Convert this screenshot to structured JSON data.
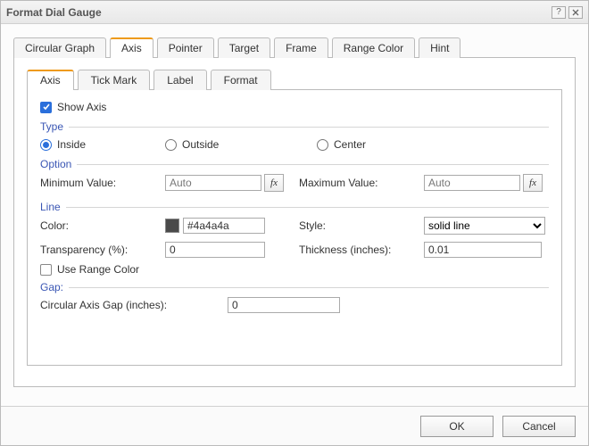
{
  "window": {
    "title": "Format Dial Gauge"
  },
  "outer_tabs": {
    "items": [
      {
        "label": "Circular Graph"
      },
      {
        "label": "Axis"
      },
      {
        "label": "Pointer"
      },
      {
        "label": "Target"
      },
      {
        "label": "Frame"
      },
      {
        "label": "Range Color"
      },
      {
        "label": "Hint"
      }
    ],
    "active": 1
  },
  "inner_tabs": {
    "items": [
      {
        "label": "Axis"
      },
      {
        "label": "Tick Mark"
      },
      {
        "label": "Label"
      },
      {
        "label": "Format"
      }
    ],
    "active": 0
  },
  "show_axis": {
    "label": "Show Axis",
    "checked": true
  },
  "groups": {
    "type": "Type",
    "option": "Option",
    "line": "Line",
    "gap": "Gap:"
  },
  "type_options": {
    "inside": "Inside",
    "outside": "Outside",
    "center": "Center",
    "selected": "inside"
  },
  "option_fields": {
    "min_label": "Minimum Value:",
    "min_value": "Auto",
    "max_label": "Maximum Value:",
    "max_value": "Auto",
    "fx_label": "fx"
  },
  "line_fields": {
    "color_label": "Color:",
    "color_value": "#4a4a4a",
    "color_hex": "#4a4a4a",
    "style_label": "Style:",
    "style_value": "solid line",
    "transparency_label": "Transparency (%):",
    "transparency_value": "0",
    "thickness_label": "Thickness (inches):",
    "thickness_value": "0.01",
    "use_range_color_label": "Use Range Color",
    "use_range_color_checked": false
  },
  "gap_fields": {
    "label": "Circular Axis Gap (inches):",
    "value": "0"
  },
  "buttons": {
    "ok": "OK",
    "cancel": "Cancel"
  }
}
